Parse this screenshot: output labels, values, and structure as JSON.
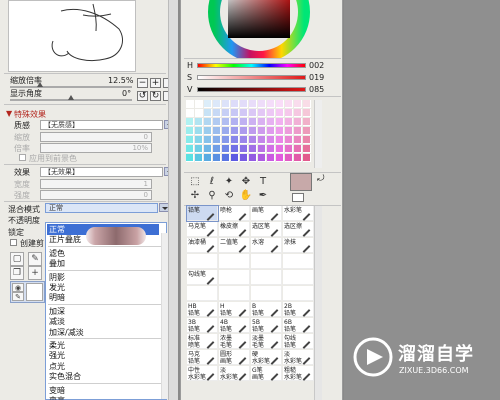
{
  "left_panel": {
    "zoom_label": "缩放倍率",
    "zoom_value": "12.5%",
    "rotate_label": "显示角度",
    "rotate_value": "0°",
    "zoom_level": 0.125,
    "section_title": "特殊效果",
    "texture_label": "质感",
    "texture_value": "【无质感】",
    "scale_label": "缩放",
    "scale_value": "0",
    "ratio_label": "倍率",
    "ratio_value": "10%",
    "apply_label": "应用到前景色",
    "effect_label": "效果",
    "effect_value": "【无效果】",
    "width_label": "宽度",
    "width_value": "1",
    "strength_label": "强度",
    "strength_value": "0",
    "blend_label": "混合模式",
    "blend_value": "正常",
    "opacity_label": "不透明度",
    "lock_label": "锁定",
    "create_label": "创建剪"
  },
  "blend_menu": {
    "items": [
      "正常",
      "正片叠底",
      "滤色",
      "叠加",
      "阴影",
      "发光",
      "明暗",
      "加深",
      "减淡",
      "加深/减淡",
      "柔光",
      "强光",
      "点光",
      "实色混合",
      "变暗",
      "变亮"
    ]
  },
  "color_panel": {
    "rows": [
      {
        "label": "H",
        "value": "002"
      },
      {
        "label": "S",
        "value": "019"
      },
      {
        "label": "V",
        "value": "085"
      }
    ],
    "main_color": "#c7a9a9",
    "hue_color": "#e01818"
  },
  "brushes": {
    "cells": [
      "铅笔",
      "喷枪",
      "画笔",
      "水彩笔",
      "马克笔",
      "橡皮擦",
      "选区笔",
      "选区擦",
      "油漆桶",
      "二值笔",
      "水溶",
      "涂抹",
      "",
      "",
      "",
      "",
      "勾线笔",
      "",
      "",
      "",
      "",
      "",
      "",
      "",
      "HB\n铅笔",
      "H\n铅笔",
      "B\n铅笔",
      "2B\n铅笔",
      "3B\n铅笔",
      "4B\n铅笔",
      "5B\n铅笔",
      "6B\n铅笔",
      "标准\n喷笔",
      "浓墨\n毛笔",
      "淡墨\n毛笔",
      "勾线\n铅笔",
      "马克\n铅笔",
      "圆形\n画笔",
      "硬\n水彩笔",
      "淡\n水彩笔",
      "中性\n水彩笔",
      "淡\n水彩笔",
      "G笔\n画笔",
      "粗糙\n水彩笔"
    ]
  },
  "watermark": {
    "name": "溜溜自学",
    "url": "ZIXUE.3D66.COM"
  }
}
